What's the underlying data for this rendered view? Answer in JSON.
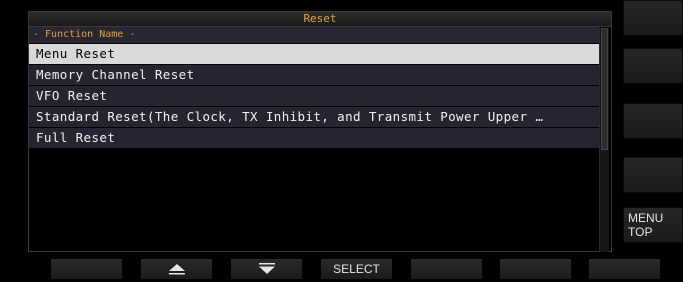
{
  "window": {
    "title": "Reset"
  },
  "list": {
    "header": "- Function Name -",
    "items": [
      "Menu Reset",
      "Memory Channel Reset",
      "VFO Reset",
      "Standard Reset(The Clock, TX Inhibit, and Transmit Power Upper …",
      "Full Reset"
    ],
    "selected_index": 0
  },
  "side_buttons": [
    "",
    "",
    "",
    "",
    "MENU\nTOP"
  ],
  "bottom_buttons": {
    "f1": "",
    "up_icon": "up-triangle-icon",
    "down_icon": "down-triangle-icon",
    "select": "SELECT",
    "f5": "",
    "f6": "",
    "f7": ""
  },
  "colors": {
    "accent_orange": "#e2a23a",
    "selected_row_bg": "#d9d9d9",
    "row_bg": "#242531"
  }
}
